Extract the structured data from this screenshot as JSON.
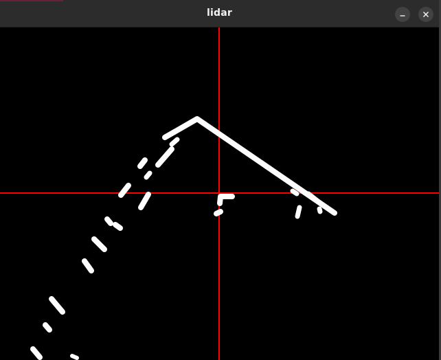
{
  "window": {
    "title": "lidar",
    "controls": {
      "minimize_icon": "minimize-icon",
      "close_icon": "close-icon"
    }
  },
  "colors": {
    "titlebar_bg": "#2c2c2c",
    "canvas_bg": "#000000",
    "crosshair": "#ff0000",
    "points": "#ffffff"
  }
}
